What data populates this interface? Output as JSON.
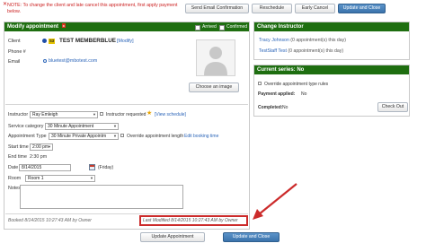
{
  "note": {
    "close_glyph": "✕",
    "text": "NOTE: To change the client and late cancel this appointment, first apply payment below."
  },
  "top_buttons": {
    "send_email": "Send Email Confirmation",
    "reschedule": "Reschedule",
    "early_cancel": "Early Cancel",
    "update_close": "Update and Close"
  },
  "modify": {
    "title": "Modify appointment",
    "flag_text": "x",
    "arrived": "Arrived",
    "confirmed": "Confirmed",
    "client_label": "Client",
    "client_badge": "S3",
    "client_name": "TEST MEMBERBLUE",
    "client_modify": "[Modify]",
    "phone_label": "Phone #",
    "email_label": "Email",
    "email_value": "bluetest@mbotest.com",
    "choose_image": "Choose an image",
    "instructor_label": "Instructor",
    "instructor_value": "Ray Emleigh",
    "instructor_requested": "Instructor requested",
    "view_schedule": "[View schedule]",
    "service_label": "Service category",
    "service_value": "30 Minute Appointment",
    "appt_type_label": "Appointment Type",
    "appt_type_value": "30 Minute Private Appointm",
    "override_length": "Override appointment length",
    "edit_booking": "Edit booking time",
    "start_label": "Start time",
    "start_value": "2:00 pm",
    "end_label": "End time",
    "end_value": "2:30 pm",
    "date_label": "Date",
    "date_value": "8/14/2015",
    "date_day": "(Friday)",
    "room_label": "Room",
    "room_value": "Room 1",
    "notes_label": "Notes",
    "booked": "Booked 8/14/2015 10:27:43 AM by Owner",
    "last_modified": "Last Modified 8/14/2015 10:27:43 AM by Owner"
  },
  "bottom_buttons": {
    "update_appointment": "Update Appointment",
    "update_close": "Update and Close"
  },
  "change_instructor": {
    "title": "Change Instructor",
    "items": [
      {
        "name": "Tracy Johnson",
        "count": "(0 appointment(s) this day)"
      },
      {
        "name": "TestStaff Test",
        "count": "(0 appointment(s) this day)"
      }
    ]
  },
  "series": {
    "title": "Current series: No",
    "override_rules": "Override appointment type rules",
    "payment_applied_label": "Payment applied:",
    "payment_applied_value": "No",
    "completed_label": "Completed:",
    "completed_value": "No",
    "check_out": "Check Out"
  },
  "colors": {
    "panel_header": "#1e6e10",
    "note_red": "#cc2222",
    "link_blue": "#2a64b8",
    "annotation_red": "#cc2b2b"
  }
}
